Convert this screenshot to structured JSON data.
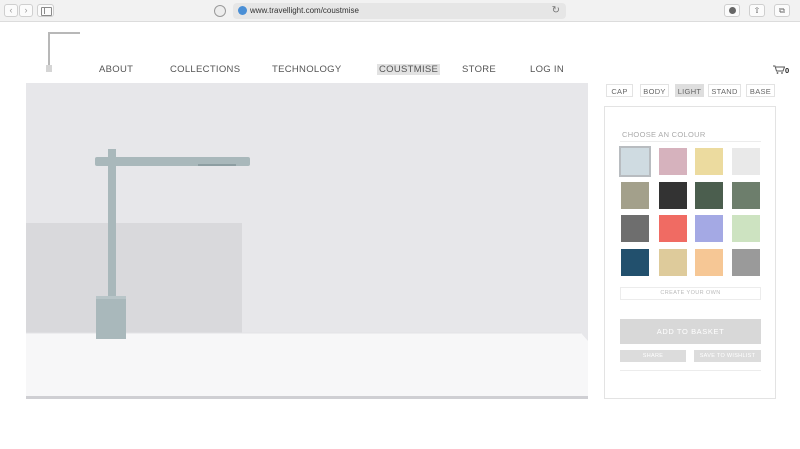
{
  "browser": {
    "back_glyph": "‹",
    "forward_glyph": "›",
    "url": "www.travellight.com/coustmise",
    "reload_glyph": "↻",
    "share_glyph": "⇧",
    "tabs_glyph": "⧉",
    "icons": [
      "chevron-left-icon",
      "chevron-right-icon",
      "sidebar-icon",
      "shield-icon",
      "globe-icon",
      "reload-icon",
      "download-icon",
      "share-icon",
      "tabs-icon"
    ]
  },
  "nav": {
    "items": [
      {
        "label": "ABOUT"
      },
      {
        "label": "COLLECTIONS"
      },
      {
        "label": "TECHNOLOGY"
      },
      {
        "label": "COUSTMISE",
        "active": true
      },
      {
        "label": "STORE"
      },
      {
        "label": "LOG IN"
      }
    ],
    "cart_count": "0"
  },
  "tabs": [
    {
      "label": "CAP"
    },
    {
      "label": "BODY"
    },
    {
      "label": "LIGHT",
      "active": true
    },
    {
      "label": "STAND"
    },
    {
      "label": "BASE"
    }
  ],
  "panel": {
    "title": "CHOOSE AN COLOUR",
    "swatches": [
      "#cfdbe1",
      "#d6b2bd",
      "#ecdb9f",
      "#e9e9e9",
      "#a3a08b",
      "#333333",
      "#4b5e4e",
      "#6d7e6c",
      "#6e6e6e",
      "#f06b63",
      "#a4a9e4",
      "#cde3c1",
      "#22506d",
      "#decb9b",
      "#f6c795",
      "#9a9a9a"
    ],
    "selected_index": 0,
    "create_label": "CREATE YOUR OWN",
    "add_to_basket_label": "ADD TO BASKET",
    "share_label": "SHARE",
    "save_label": "SAVE TO WISHLIST"
  },
  "colors": {
    "viewer_bg": "#e7e7ea",
    "lamp": "#a9b8bb",
    "floor": "#f7f7f8"
  }
}
